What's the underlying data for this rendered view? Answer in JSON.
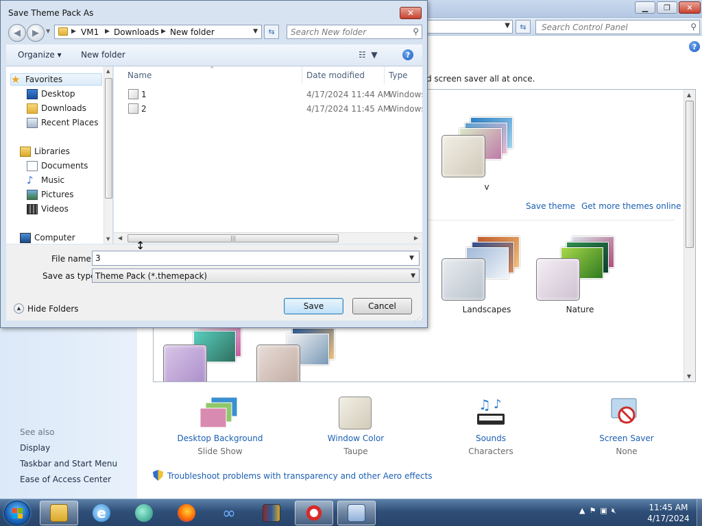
{
  "control_panel": {
    "search_placeholder": "Search Control Panel",
    "description_tail": "d screen saver all at once.",
    "save_theme": "Save theme",
    "get_more_themes": "Get more themes online",
    "themes": [
      {
        "label": "v"
      },
      {
        "label": "Landscapes"
      },
      {
        "label": "Nature"
      }
    ],
    "see_also": {
      "heading": "See also",
      "links": [
        "Display",
        "Taskbar and Start Menu",
        "Ease of Access Center"
      ]
    },
    "bottom_items": [
      {
        "label": "Desktop Background",
        "value": "Slide Show"
      },
      {
        "label": "Window Color",
        "value": "Taupe"
      },
      {
        "label": "Sounds",
        "value": "Characters"
      },
      {
        "label": "Screen Saver",
        "value": "None"
      }
    ],
    "aero_link": "Troubleshoot problems with transparency and other Aero effects"
  },
  "dialog": {
    "title": "Save Theme Pack As",
    "close_label": "✕",
    "breadcrumb": [
      "VM1",
      "Downloads",
      "New folder"
    ],
    "search_placeholder": "Search New folder",
    "toolbar": {
      "organize": "Organize ▾",
      "new_folder": "New folder"
    },
    "nav": {
      "favorites": "Favorites",
      "desktop": "Desktop",
      "downloads": "Downloads",
      "recent_places": "Recent Places",
      "libraries": "Libraries",
      "documents": "Documents",
      "music": "Music",
      "pictures": "Pictures",
      "videos": "Videos",
      "computer": "Computer"
    },
    "columns": {
      "name": "Name",
      "date_modified": "Date modified",
      "type": "Type"
    },
    "files": [
      {
        "name": "1",
        "date": "4/17/2024 11:44 AM",
        "type": "Windows"
      },
      {
        "name": "2",
        "date": "4/17/2024 11:45 AM",
        "type": "Windows"
      }
    ],
    "file_name_label": "File name:",
    "file_name_value": "3",
    "save_as_type_label": "Save as type:",
    "save_as_type_value": "Theme Pack (*.themepack)",
    "hide_folders": "Hide Folders",
    "save_button": "Save",
    "cancel_button": "Cancel"
  },
  "taskbar": {
    "time": "11:45 AM",
    "date": "4/17/2024"
  }
}
